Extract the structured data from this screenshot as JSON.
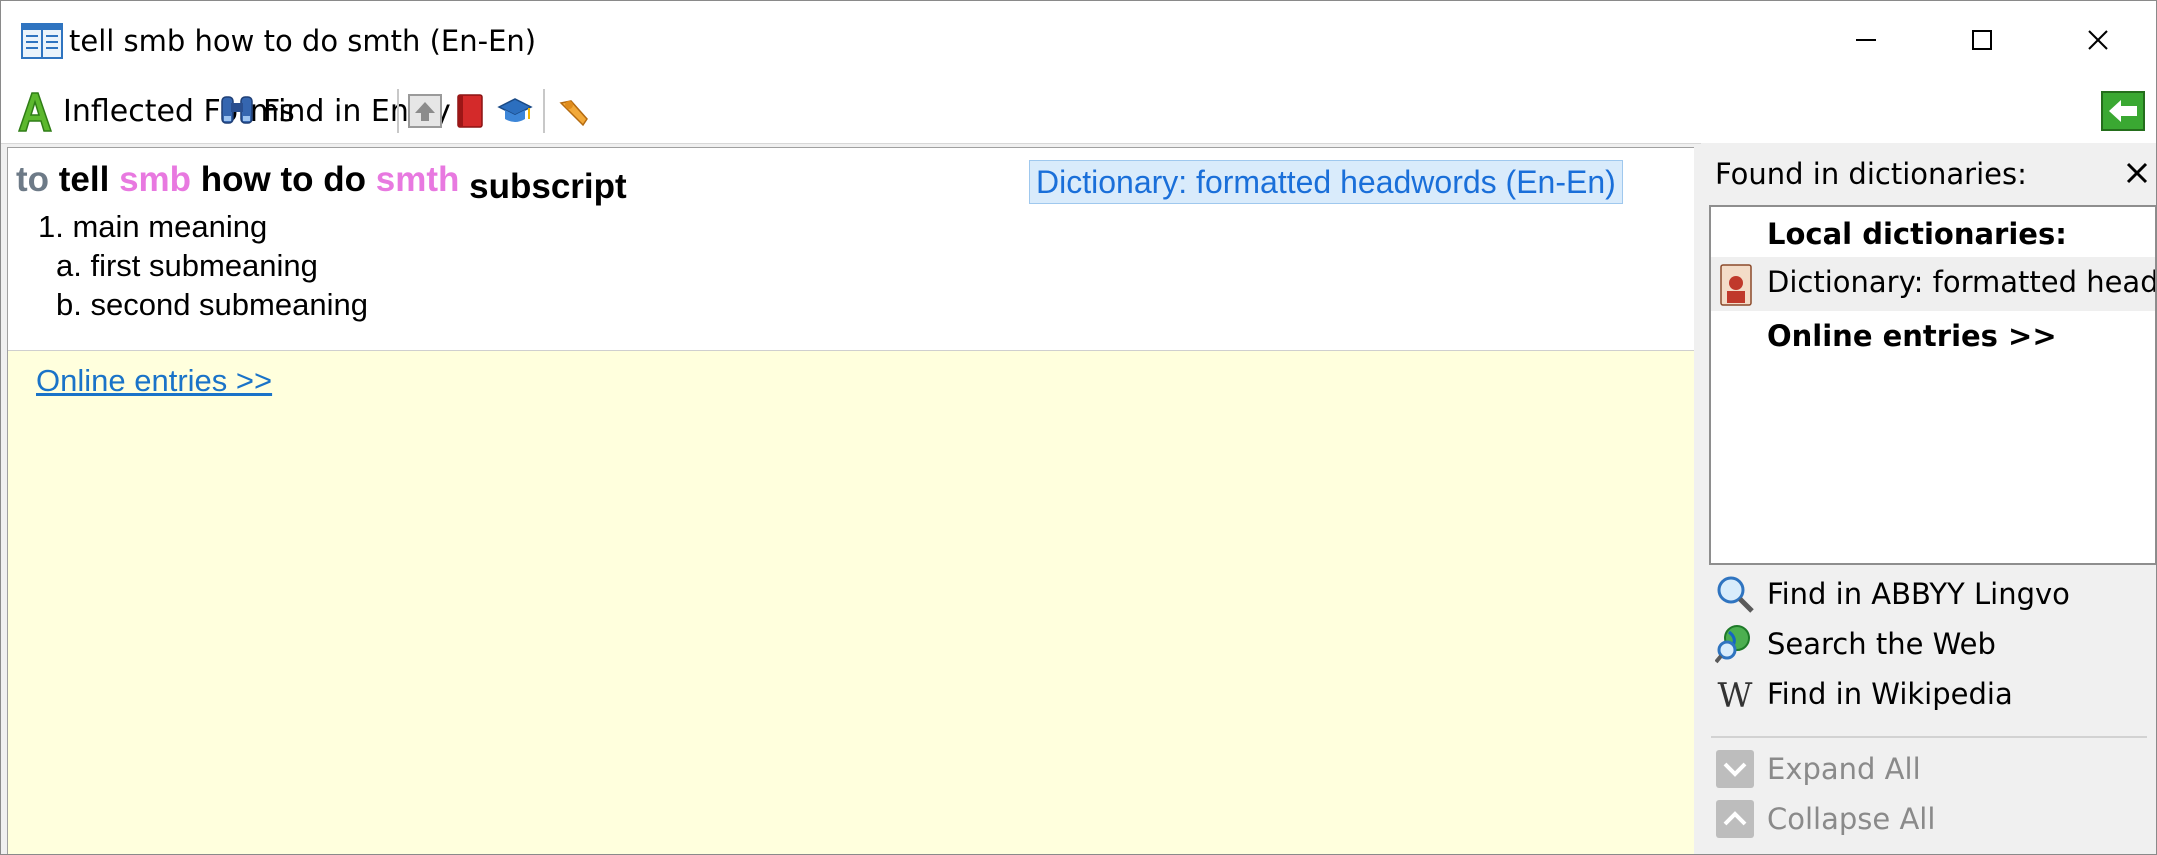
{
  "window": {
    "title": "tell smb how to do smth (En-En)"
  },
  "toolbar": {
    "inflected_forms_label": "Inflected Forms",
    "find_in_entry_label": "Find in Entry"
  },
  "entry": {
    "headword_parts": [
      {
        "text": "to",
        "style": "gray"
      },
      {
        "text": "tell",
        "style": "black"
      },
      {
        "text": "smb",
        "style": "pink"
      },
      {
        "text": "how to do",
        "style": "black"
      },
      {
        "text": "smth",
        "style": "pink"
      },
      {
        "text": "subscript",
        "style": "subscript"
      }
    ],
    "dictionary_badge": "Dictionary: formatted headwords (En-En)",
    "meanings": [
      "1. main meaning",
      "a. first submeaning",
      "b. second submeaning"
    ],
    "online_entries_link": "Online entries >>"
  },
  "side_panel": {
    "title": "Found in dictionaries:",
    "local_header": "Local dictionaries:",
    "local_item": "Dictionary: formatted headwords (En-En)",
    "online_header": "Online entries >>",
    "actions": {
      "find_lingvo": "Find in ABBYY Lingvo",
      "search_web": "Search the Web",
      "find_wikipedia": "Find in Wikipedia",
      "expand_all": "Expand All",
      "collapse_all": "Collapse All"
    }
  },
  "colors": {
    "accent_blue": "#1a6fd9",
    "link_blue": "#1a73c8",
    "pink": "#e879e0",
    "gray_word": "#6d7a87",
    "online_bg": "#ffffdd",
    "back_green": "#3aa832"
  }
}
